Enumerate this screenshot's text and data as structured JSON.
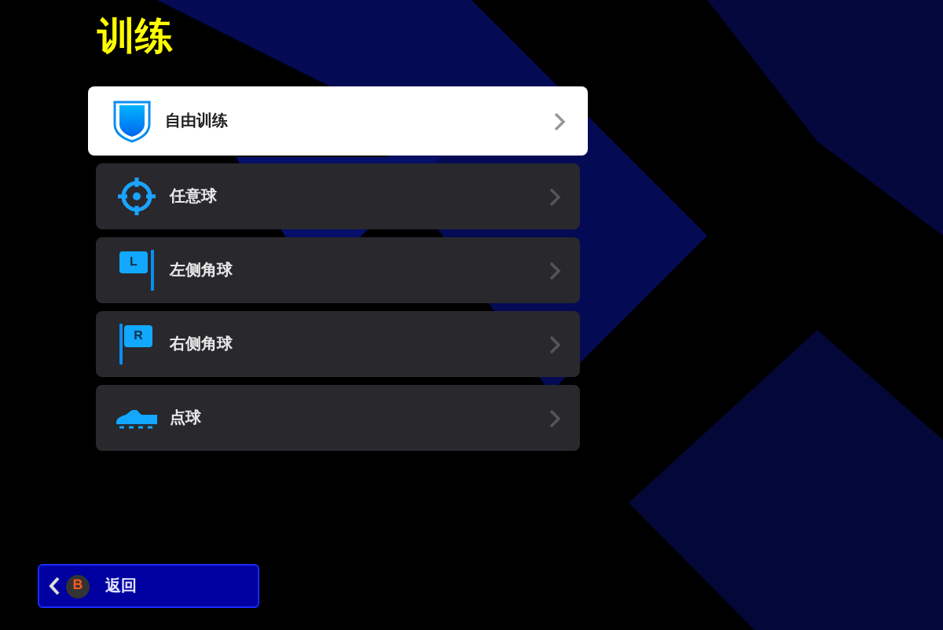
{
  "title": "训练",
  "menu": [
    {
      "label": "自由训练",
      "kind": "shield",
      "selected": true
    },
    {
      "label": "任意球",
      "kind": "target",
      "selected": false
    },
    {
      "label": "左侧角球",
      "kind": "flag",
      "flag_letter": "L",
      "selected": false
    },
    {
      "label": "右侧角球",
      "kind": "flag",
      "flag_letter": "R",
      "selected": false
    },
    {
      "label": "点球",
      "kind": "boot",
      "selected": false
    }
  ],
  "back_button": {
    "label": "返回",
    "key": "B"
  }
}
